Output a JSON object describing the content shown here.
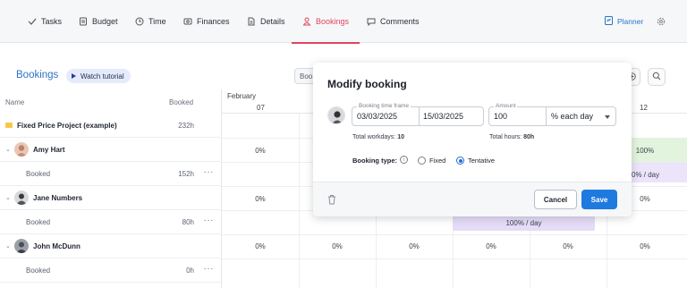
{
  "tabs": [
    {
      "label": "Tasks",
      "icon": "tasks-icon"
    },
    {
      "label": "Budget",
      "icon": "budget-icon"
    },
    {
      "label": "Time",
      "icon": "clock-icon"
    },
    {
      "label": "Finances",
      "icon": "finances-icon"
    },
    {
      "label": "Details",
      "icon": "document-icon"
    },
    {
      "label": "Bookings",
      "icon": "bookings-icon",
      "active": true
    },
    {
      "label": "Comments",
      "icon": "comment-icon"
    }
  ],
  "header": {
    "planner_label": "Planner"
  },
  "bookings": {
    "title": "Bookings",
    "watch_label": "Watch tutorial",
    "search_text": "Boo"
  },
  "table": {
    "col_name": "Name",
    "col_booked": "Booked",
    "rows": [
      {
        "name": "Fixed Price Project (example)",
        "value": "232h"
      },
      {
        "name": "Amy Hart"
      },
      {
        "sub": "Booked",
        "value": "152h"
      },
      {
        "name": "Jane Numbers"
      },
      {
        "sub": "Booked",
        "value": "80h"
      },
      {
        "name": "John McDunn"
      },
      {
        "sub": "Booked",
        "value": "0h"
      }
    ]
  },
  "grid": {
    "month": "February",
    "day_first": "07",
    "day_last": "12",
    "row1": [
      "0%",
      "0%",
      "100%"
    ],
    "row1b": [
      "0% / day"
    ],
    "row2": [
      "0%",
      "0%"
    ],
    "row2b": [
      "100% / day"
    ],
    "row3": [
      "0%",
      "0%",
      "0%",
      "0%",
      "0%",
      "0%"
    ]
  },
  "modal": {
    "title": "Modify booking",
    "timeframe_legend": "Booking time frame",
    "date_from": "03/03/2025",
    "date_to": "15/03/2025",
    "amount_legend": "Amount",
    "amount": "100",
    "amount_unit": "% each day",
    "workdays_label": "Total workdays:",
    "workdays_value": "10",
    "hours_label": "Total hours:",
    "hours_value": "80h",
    "booking_type_label": "Booking type:",
    "option_fixed": "Fixed",
    "option_tentative": "Tentative",
    "selected_type": "Tentative",
    "cancel_label": "Cancel",
    "save_label": "Save"
  },
  "colors": {
    "accent_blue": "#1f7ae0",
    "active_tab": "#e0455f",
    "allocation_green": "#e3f4de",
    "allocation_purple": "#ece4fb"
  }
}
